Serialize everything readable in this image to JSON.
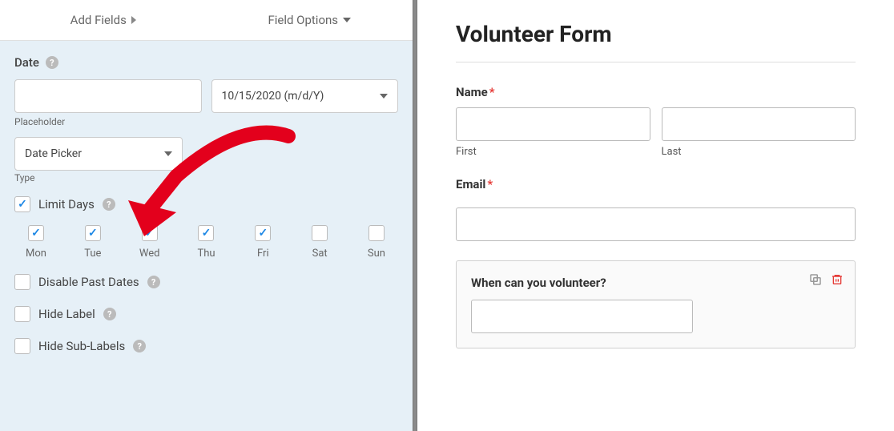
{
  "tabs": {
    "add_fields": "Add Fields",
    "field_options": "Field Options"
  },
  "date": {
    "label": "Date",
    "placeholder_value": "",
    "placeholder_label": "Placeholder",
    "format_value": "10/15/2020 (m/d/Y)",
    "type_label": "Type",
    "type_value": "Date Picker"
  },
  "limit_days": {
    "label": "Limit Days",
    "checked": true,
    "days": [
      {
        "label": "Mon",
        "checked": true
      },
      {
        "label": "Tue",
        "checked": true
      },
      {
        "label": "Wed",
        "checked": true
      },
      {
        "label": "Thu",
        "checked": true
      },
      {
        "label": "Fri",
        "checked": true
      },
      {
        "label": "Sat",
        "checked": false
      },
      {
        "label": "Sun",
        "checked": false
      }
    ]
  },
  "options": {
    "disable_past_dates": {
      "label": "Disable Past Dates",
      "checked": false
    },
    "hide_label": {
      "label": "Hide Label",
      "checked": false
    },
    "hide_sublabels": {
      "label": "Hide Sub-Labels",
      "checked": false
    }
  },
  "form": {
    "title": "Volunteer Form",
    "name": {
      "label": "Name",
      "first_label": "First",
      "last_label": "Last"
    },
    "email": {
      "label": "Email"
    },
    "volunteer": {
      "label": "When can you volunteer?"
    }
  }
}
